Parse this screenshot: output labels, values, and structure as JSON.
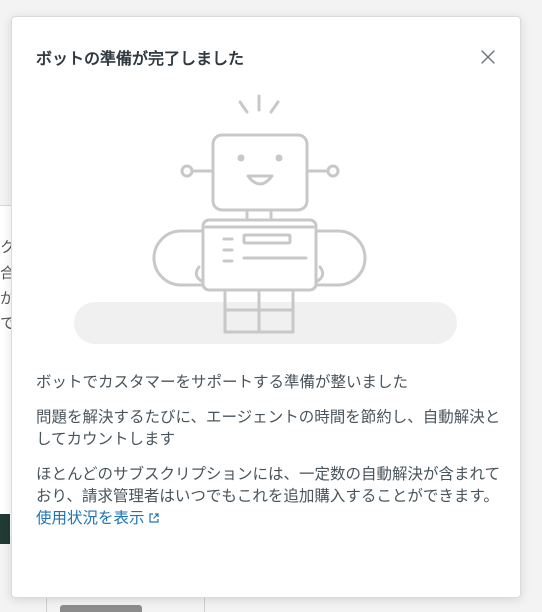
{
  "modal": {
    "title": "ボットの準備が完了しました",
    "paragraph1": "ボットでカスタマーをサポートする準備が整いました",
    "paragraph2": "問題を解決するたびに、エージェントの時間を節約し、自動解決としてカウントします",
    "paragraph3_text": "ほとんどのサブスクリプションには、一定数の自動解決が含まれており、請求管理者はいつでもこれを追加購入することができます。",
    "paragraph3_link": "使用状況を表示"
  },
  "background": {
    "glyphs": [
      "ク",
      "合",
      "が",
      "で"
    ]
  },
  "icons": {
    "close": "close-icon",
    "external": "external-link-icon",
    "illustration": "robot-illustration"
  },
  "colors": {
    "title": "#2f3941",
    "body_text": "#49545c",
    "link": "#1f73b7",
    "illustration_stroke": "#c8c8c8",
    "illustration_shadow": "#f0f0f0"
  }
}
